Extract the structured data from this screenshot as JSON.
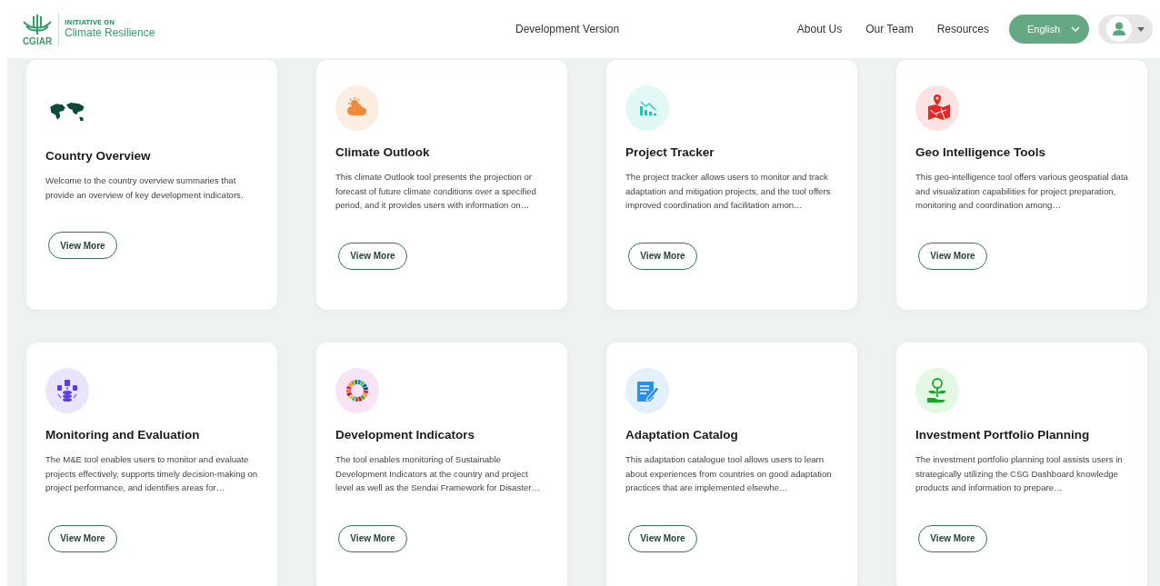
{
  "header": {
    "logo": {
      "mark_text": "CGIAR",
      "kicker": "INITIATIVE ON",
      "name": "Climate Resilience"
    },
    "version_label": "Development Version",
    "nav": [
      "About Us",
      "Our Team",
      "Resources"
    ],
    "language": {
      "value": "English"
    }
  },
  "cards": [
    {
      "title": "Country Overview",
      "description": "Welcome to the country overview summaries that provide an overview of key development indicators.",
      "button": "View More"
    },
    {
      "title": "Climate Outlook",
      "description": "This climate Outlook tool presents the projection or forecast of future climate conditions over a specified period, and it provides users with information on…",
      "button": "View More"
    },
    {
      "title": "Project Tracker",
      "description": "The project tracker allows users to monitor and track adaptation and mitigation projects, and the tool offers improved coordination and facilitation amon…",
      "button": "View More"
    },
    {
      "title": "Geo Intelligence Tools",
      "description": "This geo-intelligence tool offers various geospatial data and visualization capabilities for project preparation, monitoring and coordination among…",
      "button": "View More"
    },
    {
      "title": "Monitoring and Evaluation",
      "description": "The M&E tool enables users to monitor and evaluate projects effectively, supports timely decision-making on project performance, and identifies areas for…",
      "button": "View More"
    },
    {
      "title": "Development Indicators",
      "description": "The tool enables monitoring of Sustainable Development Indicators at the country and project level as well as the Sendai Framework for Disaster…",
      "button": "View More"
    },
    {
      "title": "Adaptation Catalog",
      "description": "This adaptation catalogue tool allows users to learn about experiences from countries on good adaptation practices that are implemented elsewhe…",
      "button": "View More"
    },
    {
      "title": "Investment Portfolio Planning",
      "description": "The investment portfolio planning tool assists users in strategically utilizing the CSG Dashboard knowledge products and information to prepare…",
      "button": "View More"
    }
  ]
}
